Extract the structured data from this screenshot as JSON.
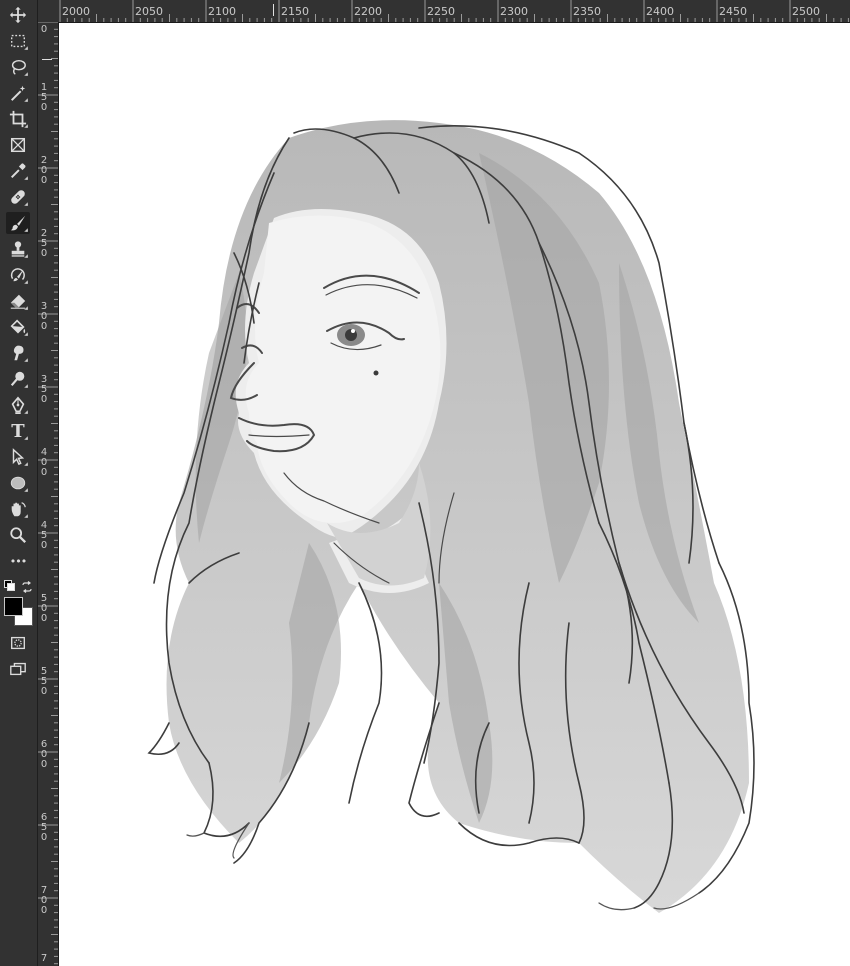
{
  "rulers": {
    "horizontal": [
      "2000",
      "2050",
      "2100",
      "2150",
      "2200",
      "2250",
      "2300",
      "2350",
      "2400",
      "2450",
      "2500"
    ],
    "vertical": [
      "0",
      "150",
      "200",
      "250",
      "300",
      "350",
      "400",
      "450",
      "500",
      "550",
      "600",
      "650",
      "700",
      "7"
    ]
  },
  "toolbar": {
    "tools": [
      {
        "name": "move-tool",
        "icon": "move-icon"
      },
      {
        "name": "rectangular-marquee-tool",
        "icon": "marquee-icon"
      },
      {
        "name": "lasso-tool",
        "icon": "lasso-icon"
      },
      {
        "name": "magic-wand-tool",
        "icon": "magic-wand-icon"
      },
      {
        "name": "crop-tool",
        "icon": "crop-icon"
      },
      {
        "name": "frame-tool",
        "icon": "frame-icon"
      },
      {
        "name": "eyedropper-tool",
        "icon": "eyedropper-icon"
      },
      {
        "name": "healing-brush-tool",
        "icon": "bandage-icon"
      },
      {
        "name": "brush-tool",
        "icon": "brush-icon",
        "active": true
      },
      {
        "name": "clone-stamp-tool",
        "icon": "stamp-icon"
      },
      {
        "name": "history-brush-tool",
        "icon": "history-brush-icon"
      },
      {
        "name": "eraser-tool",
        "icon": "eraser-icon"
      },
      {
        "name": "paint-bucket-tool",
        "icon": "paint-bucket-icon"
      },
      {
        "name": "smudge-tool",
        "icon": "smudge-icon"
      },
      {
        "name": "dodge-tool",
        "icon": "dodge-icon"
      },
      {
        "name": "pen-tool",
        "icon": "pen-icon"
      },
      {
        "name": "type-tool",
        "icon": "type-icon"
      },
      {
        "name": "path-selection-tool",
        "icon": "arrow-icon"
      },
      {
        "name": "ellipse-tool",
        "icon": "ellipse-icon"
      },
      {
        "name": "rotate-view-tool",
        "icon": "hand-rotate-icon"
      },
      {
        "name": "zoom-tool",
        "icon": "zoom-icon"
      },
      {
        "name": "edit-toolbar",
        "icon": "more-icon"
      }
    ],
    "type_tool_glyph": "T",
    "more_glyph": "•••"
  },
  "colors": {
    "foreground": "#000000",
    "background": "#ffffff",
    "accent": "#1f1f1f"
  }
}
